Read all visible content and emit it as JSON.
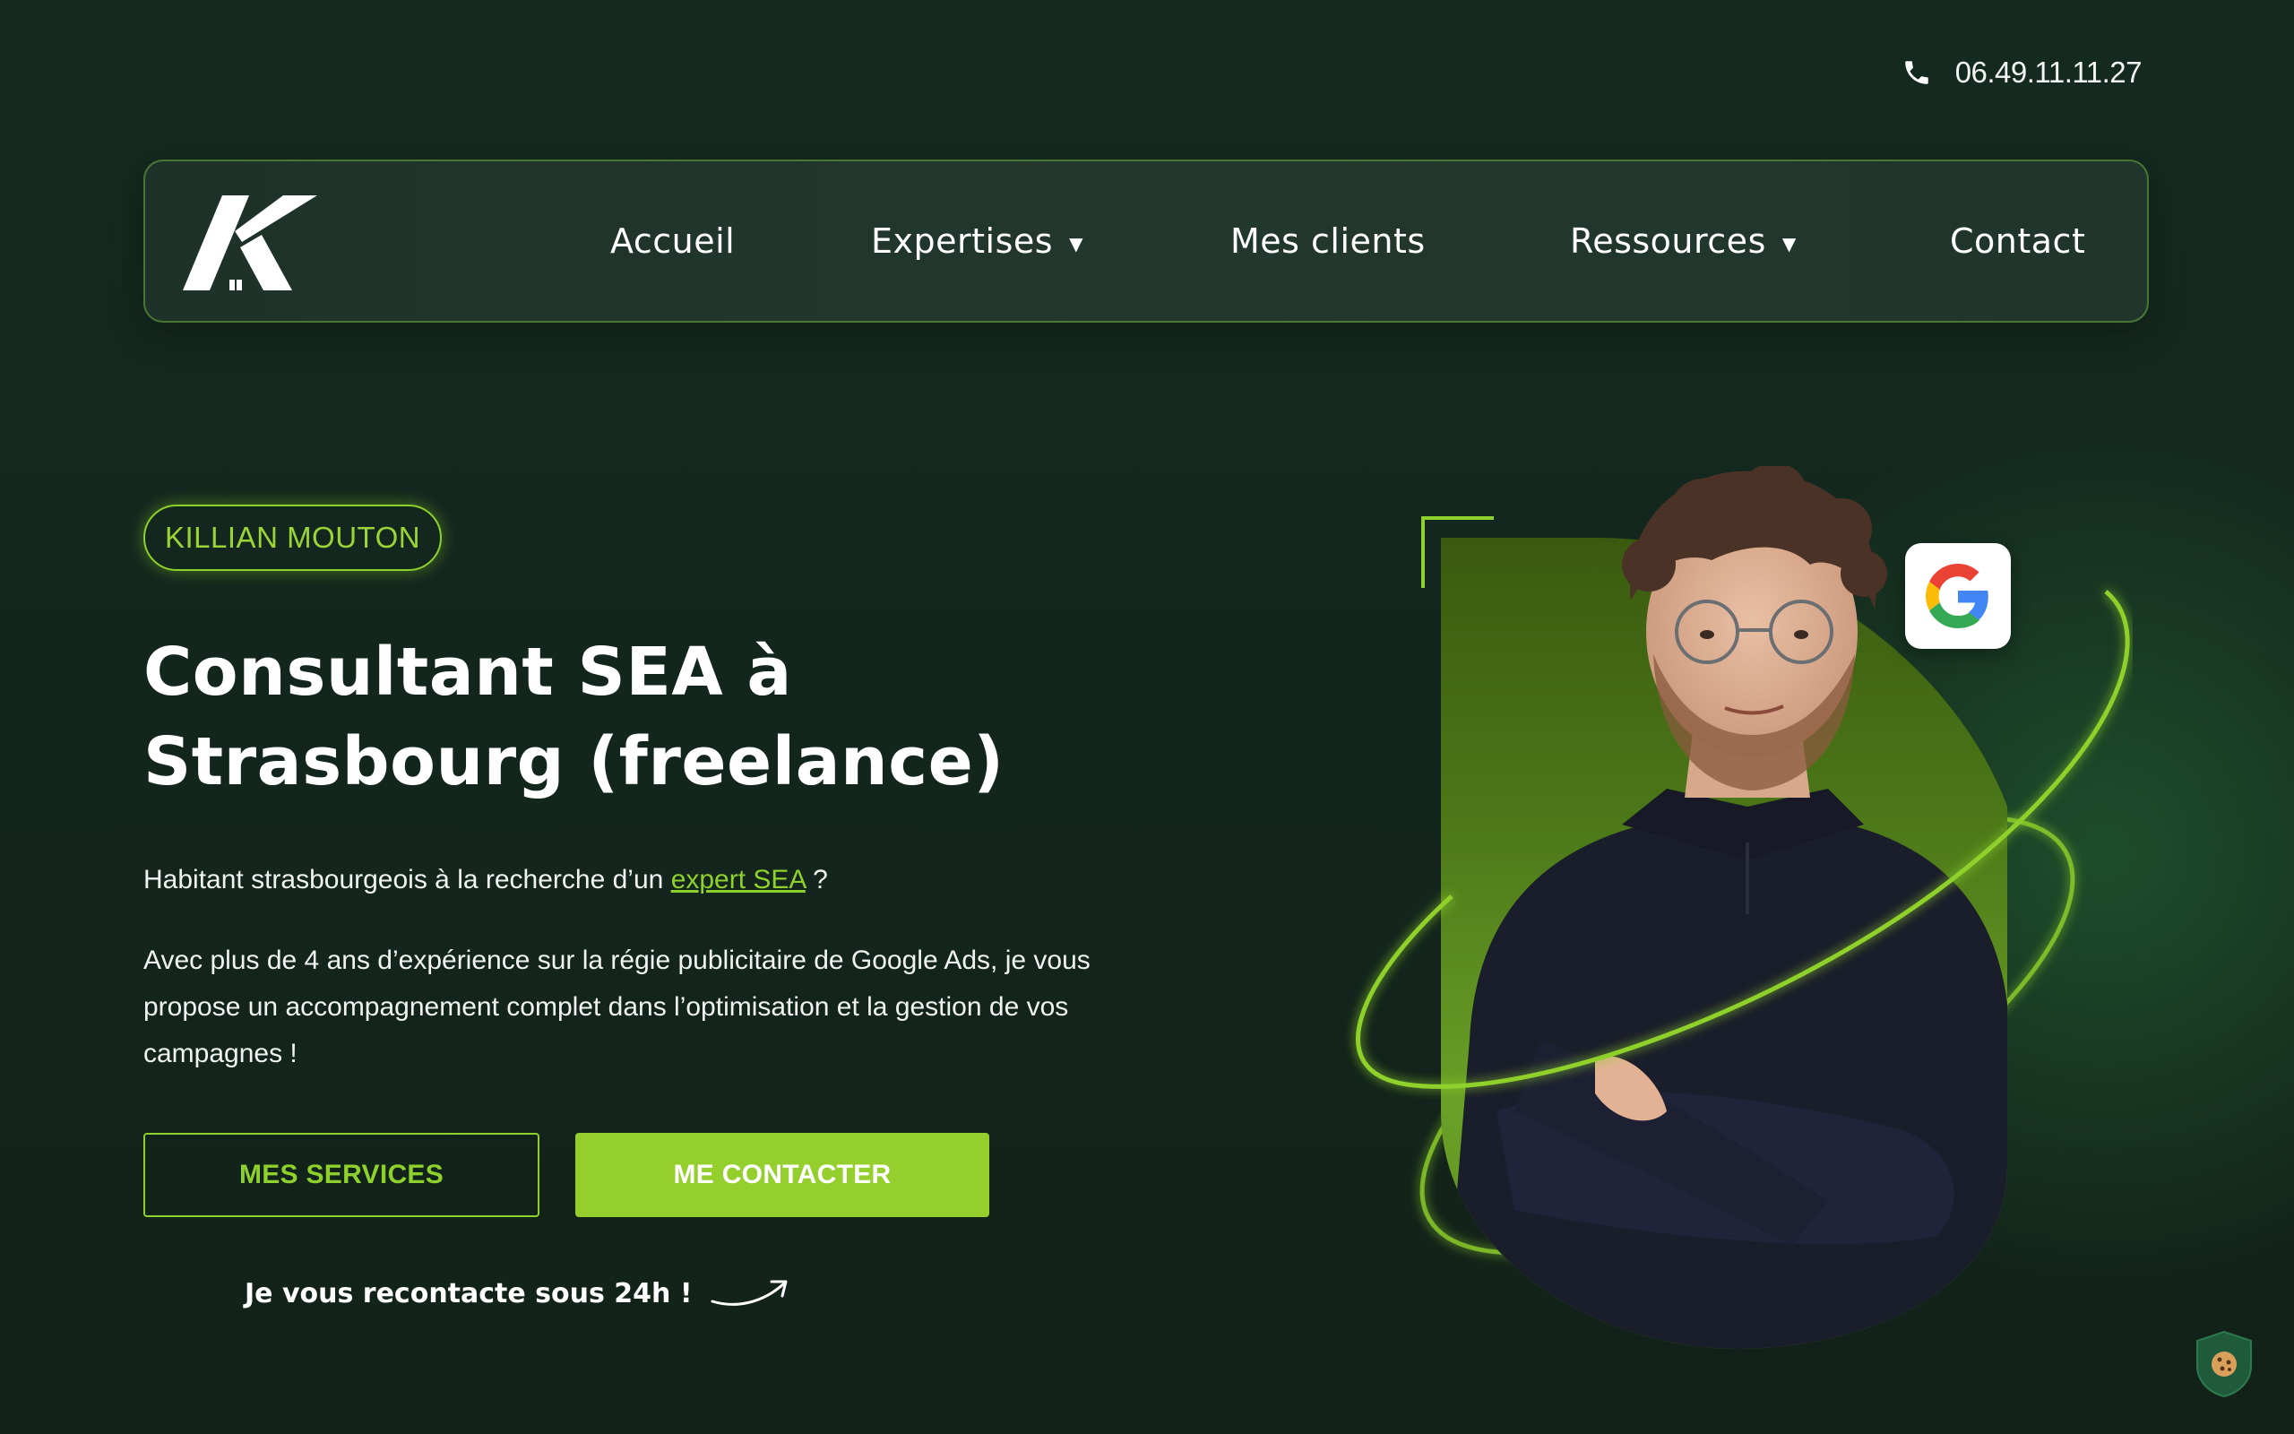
{
  "topbar": {
    "phone_number": "06.49.11.11.27",
    "phone_icon": "phone-icon"
  },
  "nav": {
    "logo_icon": "logo-k-icon",
    "items": [
      {
        "label": "Accueil",
        "has_dropdown": false
      },
      {
        "label": "Expertises",
        "has_dropdown": true
      },
      {
        "label": "Mes clients",
        "has_dropdown": false
      },
      {
        "label": "Ressources",
        "has_dropdown": true
      },
      {
        "label": "Contact",
        "has_dropdown": false
      }
    ],
    "caret": "▼"
  },
  "hero": {
    "badge": "KILLIAN MOUTON",
    "title_line1": "Consultant SEA à",
    "title_line2": "Strasbourg (freelance)",
    "intro_before": "Habitant strasbourgeois à la recherche d’un ",
    "intro_link": "expert SEA",
    "intro_after": " ?",
    "paragraph": "Avec plus de 4 ans d’expérience sur la régie publicitaire de Google Ads, je vous propose un accompagnement complet dans l’optimisation et la gestion de vos campagnes !",
    "btn_services": "MES SERVICES",
    "btn_contact": "ME CONTACTER",
    "callback_note": "Je vous recontacte sous 24h !"
  },
  "visual": {
    "google_icon": "google-g-icon",
    "portrait": "consultant-portrait"
  },
  "cookie": {
    "icon": "cookie-icon"
  },
  "colors": {
    "background": "#13261d",
    "accent": "#95cf2e",
    "accent_text": "#8fd12c",
    "nav_bg": "#22372d",
    "text": "#ffffff"
  }
}
